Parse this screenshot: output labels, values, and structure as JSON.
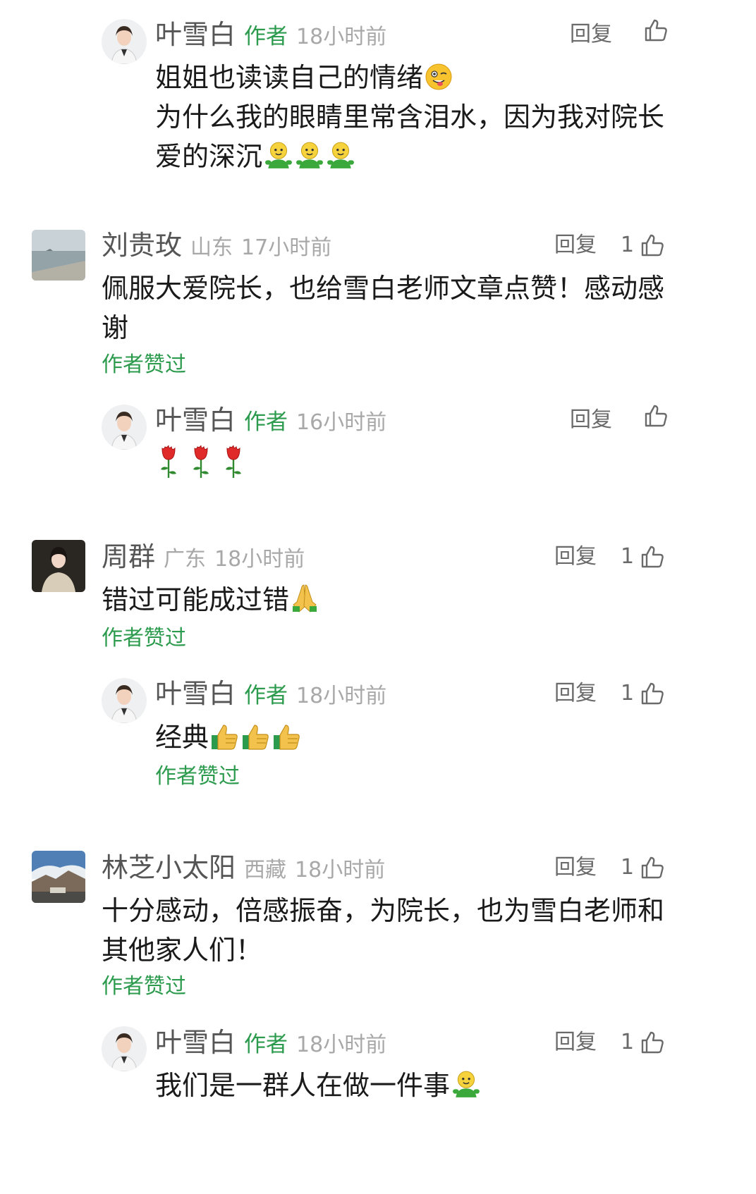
{
  "labels": {
    "reply": "回复",
    "author": "作者",
    "author_liked": "作者赞过"
  },
  "colors": {
    "green": "#2c9b4e",
    "meta": "#a8a8a8",
    "name": "#555555"
  },
  "comments": [
    {
      "name": "叶雪白",
      "tag": "作者",
      "time": "18小时前",
      "likes": "",
      "line1": "姐姐也读读自己的情绪",
      "line2": "为什么我的眼睛里常含泪水，因为我对院长",
      "line3": "爱的深沉",
      "emojis": [
        "wink-tongue",
        "green-man",
        "green-man",
        "green-man"
      ]
    },
    {
      "name": "刘贵玫",
      "location": "山东",
      "time": "17小时前",
      "likes": "1",
      "line1": "佩服大爱院长，也给雪白老师文章点赞！感动感",
      "line2": "谢",
      "author_liked": true
    },
    {
      "name": "叶雪白",
      "tag": "作者",
      "time": "16小时前",
      "likes": "",
      "emojis": [
        "rose",
        "rose",
        "rose"
      ]
    },
    {
      "name": "周群",
      "location": "广东",
      "time": "18小时前",
      "likes": "1",
      "line1": "错过可能成过错",
      "emojis": [
        "praying-hands"
      ],
      "author_liked": true
    },
    {
      "name": "叶雪白",
      "tag": "作者",
      "time": "18小时前",
      "likes": "1",
      "line1": "经典",
      "emojis": [
        "thumbs-up",
        "thumbs-up",
        "thumbs-up"
      ],
      "author_liked": true
    },
    {
      "name": "林芝小太阳",
      "location": "西藏",
      "time": "18小时前",
      "likes": "1",
      "line1": "十分感动，倍感振奋，为院长，也为雪白老师和",
      "line2": "其他家人们！",
      "author_liked": true
    },
    {
      "name": "叶雪白",
      "tag": "作者",
      "time": "18小时前",
      "likes": "1",
      "line1": "我们是一群人在做一件事",
      "emojis": [
        "green-man"
      ]
    }
  ]
}
